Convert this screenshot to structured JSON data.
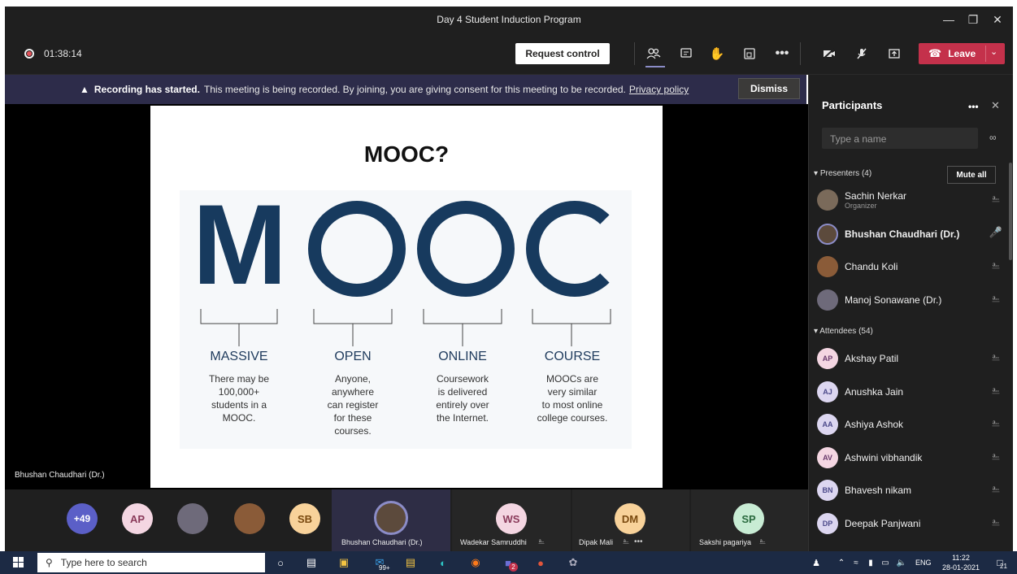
{
  "window": {
    "title": "Day 4 Student Induction Program"
  },
  "toolbar": {
    "timer": "01:38:14",
    "request_control": "Request control",
    "leave_label": "Leave"
  },
  "banner": {
    "bold": "Recording has started.",
    "text": "This meeting is being recorded. By joining, you are giving consent for this meeting to be recorded.",
    "link": "Privacy policy",
    "dismiss": "Dismiss"
  },
  "stage": {
    "presenter_name": "Bhushan Chaudhari (Dr.)"
  },
  "slide": {
    "title": "MOOC?",
    "letters": [
      "M",
      "O",
      "O",
      "C"
    ],
    "columns": [
      {
        "heading": "MASSIVE",
        "lines": [
          "There may be",
          "100,000+",
          "students in a",
          "MOOC."
        ]
      },
      {
        "heading": "OPEN",
        "lines": [
          "Anyone,",
          "anywhere",
          "can register",
          "for these",
          "courses."
        ]
      },
      {
        "heading": "ONLINE",
        "lines": [
          "Coursework",
          "is delivered",
          "entirely over",
          "the Internet."
        ]
      },
      {
        "heading": "COURSE",
        "lines": [
          "MOOCs are",
          "very similar",
          "to most online",
          "college courses."
        ]
      }
    ]
  },
  "participants": {
    "title": "Participants",
    "search_placeholder": "Type a name",
    "presenters_label": "Presenters (4)",
    "mute_all": "Mute all",
    "presenters": [
      {
        "name": "Sachin Nerkar",
        "role": "Organizer"
      },
      {
        "name": "Bhushan Chaudhari (Dr.)",
        "role": ""
      },
      {
        "name": "Chandu Koli",
        "role": ""
      },
      {
        "name": "Manoj Sonawane (Dr.)",
        "role": ""
      }
    ],
    "attendees_label": "Attendees (54)",
    "attendees": [
      {
        "initials": "AP",
        "name": "Akshay Patil"
      },
      {
        "initials": "AJ",
        "name": "Anushka Jain"
      },
      {
        "initials": "AA",
        "name": "Ashiya Ashok"
      },
      {
        "initials": "AV",
        "name": "Ashwini vibhandik"
      },
      {
        "initials": "BN",
        "name": "Bhavesh nikam"
      },
      {
        "initials": "DP",
        "name": "Deepak Panjwani"
      }
    ]
  },
  "strip": {
    "overflow": "+49",
    "small": [
      "AP",
      "SB"
    ],
    "active_name": "Bhushan Chaudhari (Dr.)",
    "tiles": [
      {
        "initials": "WS",
        "name": "Wadekar Samruddhi"
      },
      {
        "initials": "DM",
        "name": "Dipak Mali"
      },
      {
        "initials": "SP",
        "name": "Sakshi pagariya"
      }
    ]
  },
  "taskbar": {
    "search_placeholder": "Type here to search",
    "mail_badge": "99+",
    "teams_badge": "2",
    "lang": "ENG",
    "time": "11:22",
    "date": "28-01-2021",
    "notif": "21"
  }
}
